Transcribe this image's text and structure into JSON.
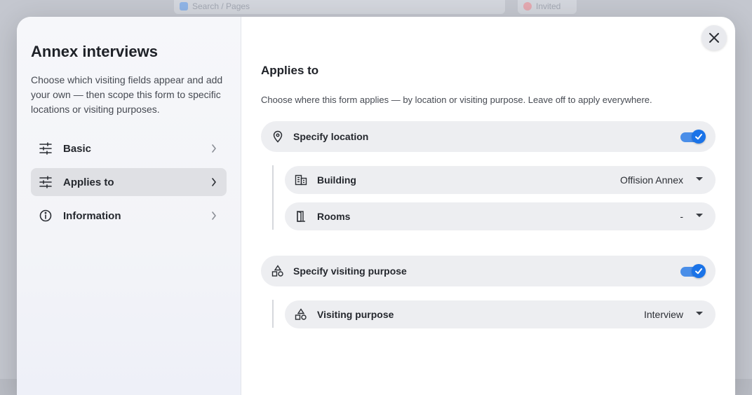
{
  "background": {
    "search_text": "Search / Pages",
    "pill_text": "Invited"
  },
  "sidebar": {
    "title": "Annex interviews",
    "description": "Choose which visiting fields appear and add your own — then scope this form to specific locations or visiting purposes.",
    "items": [
      {
        "label": "Basic",
        "icon": "sliders-icon",
        "active": false
      },
      {
        "label": "Applies to",
        "icon": "sliders-icon",
        "active": true
      },
      {
        "label": "Information",
        "icon": "info-icon",
        "active": false
      }
    ]
  },
  "main": {
    "title": "Applies to",
    "description": "Choose where this form applies — by location or visiting purpose. Leave off to apply everywhere.",
    "location": {
      "label": "Specify location",
      "icon": "location-pin-icon",
      "enabled": true,
      "fields": [
        {
          "label": "Building",
          "value": "Offision Annex",
          "icon": "building-icon"
        },
        {
          "label": "Rooms",
          "value": "-",
          "icon": "door-icon"
        }
      ]
    },
    "purpose": {
      "label": "Specify visiting purpose",
      "icon": "shapes-icon",
      "enabled": true,
      "fields": [
        {
          "label": "Visiting purpose",
          "value": "Interview",
          "icon": "shapes-icon"
        }
      ]
    }
  },
  "colors": {
    "accent": "#1a73e8",
    "active_nav": "#dfe0e4",
    "row_bg": "#edeef1"
  }
}
